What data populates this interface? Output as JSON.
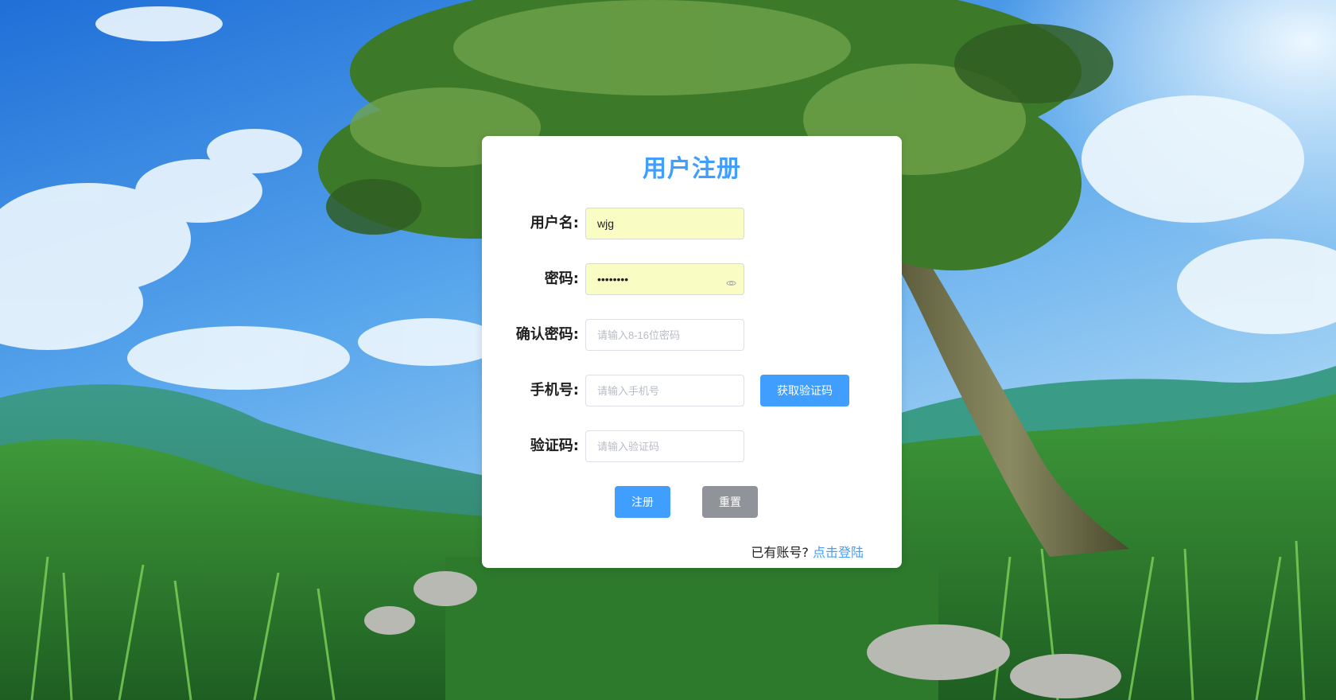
{
  "form": {
    "title": "用户注册",
    "username": {
      "label": "用户名:",
      "value": "wjg"
    },
    "password": {
      "label": "密码:",
      "value": "wjg12345"
    },
    "confirm_password": {
      "label": "确认密码:",
      "placeholder": "请输入8-16位密码"
    },
    "phone": {
      "label": "手机号:",
      "placeholder": "请输入手机号",
      "get_code_label": "获取验证码"
    },
    "code": {
      "label": "验证码:",
      "placeholder": "请输入验证码"
    },
    "submit_label": "注册",
    "reset_label": "重置",
    "footer_text": "已有账号?",
    "login_link_text": "点击登陆"
  },
  "colors": {
    "accent": "#409eff",
    "reset_button": "#909399",
    "autofill": "#fafdc3"
  },
  "icons": {
    "password_toggle": "eye-icon"
  }
}
